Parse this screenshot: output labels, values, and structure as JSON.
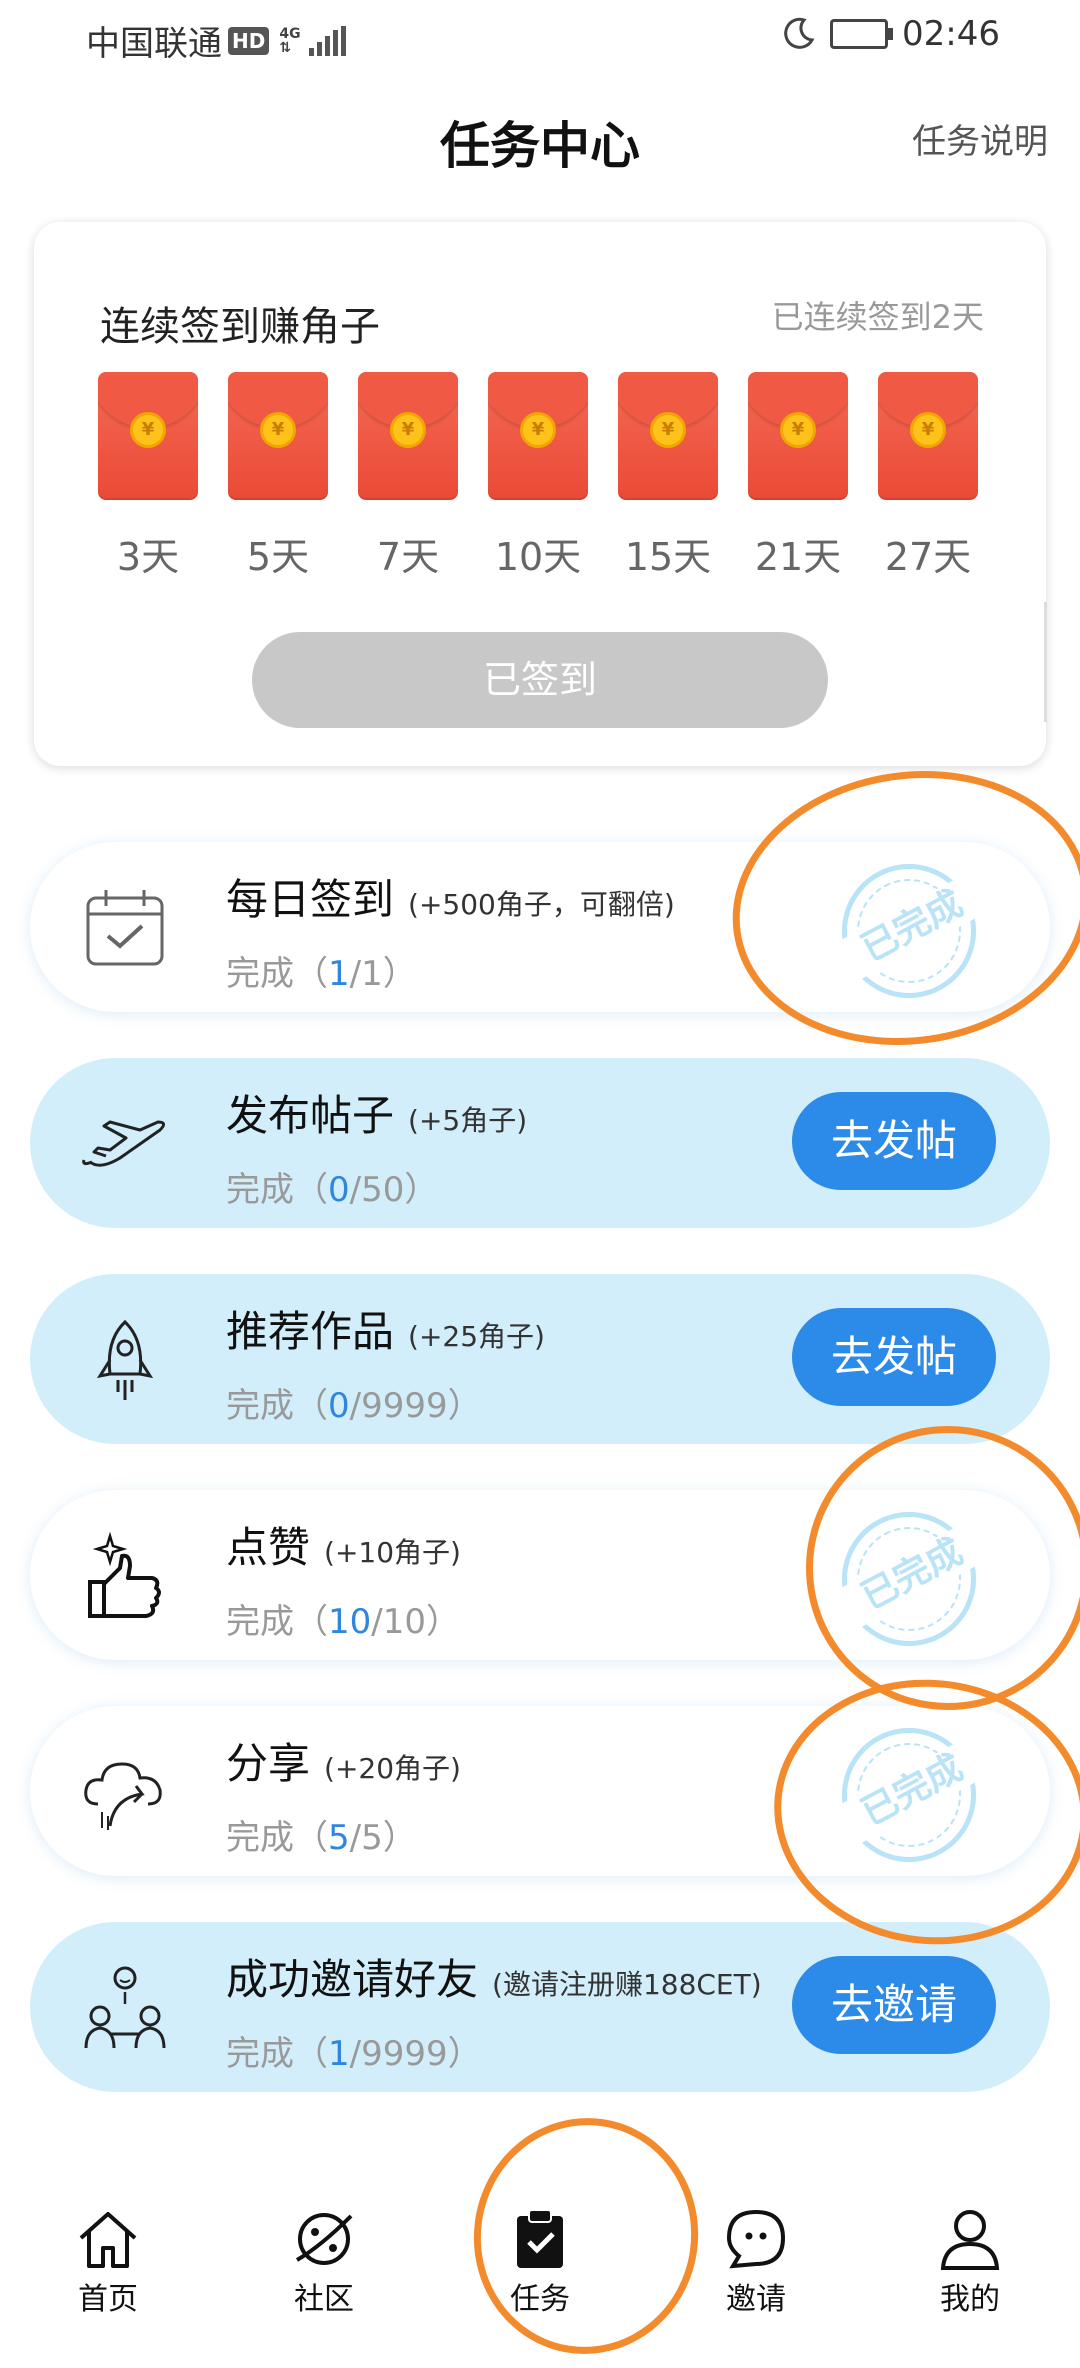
{
  "status_bar": {
    "carrier": "中国联通",
    "hd": "HD",
    "network": "4G",
    "time": "02:46"
  },
  "header": {
    "title": "任务中心",
    "task_desc": "任务说明"
  },
  "signin": {
    "title": "连续签到赚角子",
    "status": "已连续签到2天",
    "days": [
      "3天",
      "5天",
      "7天",
      "10天",
      "15天",
      "21天",
      "27天"
    ],
    "button": "已签到",
    "coin_symbol": "¥"
  },
  "tasks": [
    {
      "name": "每日签到",
      "reward": "(+500角子，可翻倍)",
      "progress_label": "完成（",
      "current": "1",
      "total": "/1）",
      "state": "已完成"
    },
    {
      "name": "发布帖子",
      "reward": "(+5角子)",
      "progress_label": "完成（",
      "current": "0",
      "total": "/50）",
      "button": "去发帖"
    },
    {
      "name": "推荐作品",
      "reward": "(+25角子)",
      "progress_label": "完成（",
      "current": "0",
      "total": "/9999）",
      "button": "去发帖"
    },
    {
      "name": "点赞",
      "reward": "(+10角子)",
      "progress_label": "完成（",
      "current": "10",
      "total": "/10）",
      "state": "已完成"
    },
    {
      "name": "分享",
      "reward": "(+20角子)",
      "progress_label": "完成（",
      "current": "5",
      "total": "/5）",
      "state": "已完成"
    },
    {
      "name": "成功邀请好友",
      "reward": "(邀请注册赚188CET)",
      "progress_label": "完成（",
      "current": "1",
      "total": "/9999）",
      "button": "去邀请"
    }
  ],
  "tabs": [
    {
      "label": "首页",
      "icon": "home-icon"
    },
    {
      "label": "社区",
      "icon": "planet-icon"
    },
    {
      "label": "任务",
      "icon": "clipboard-check-icon",
      "active": true
    },
    {
      "label": "邀请",
      "icon": "chat-bubble-icon"
    },
    {
      "label": "我的",
      "icon": "person-icon"
    }
  ],
  "colors": {
    "accent_blue": "#2c8ae8",
    "task_bg_blue": "#d2eefb",
    "red_envelope": "#ea4a36",
    "annotation_orange": "#f38a2c"
  }
}
